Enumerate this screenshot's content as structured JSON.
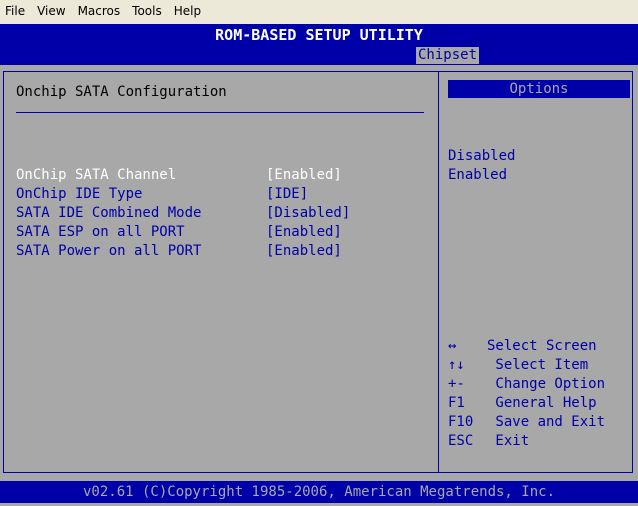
{
  "menubar": {
    "items": [
      "File",
      "View",
      "Macros",
      "Tools",
      "Help"
    ]
  },
  "bios": {
    "title": "ROM-BASED SETUP UTILITY",
    "active_tab": "Chipset",
    "section_title": "Onchip SATA Configuration",
    "settings": [
      {
        "label": "OnChip SATA Channel",
        "value": "[Enabled]",
        "selected": true
      },
      {
        "label": "OnChip IDE Type",
        "value": "[IDE]",
        "selected": false
      },
      {
        "label": "SATA IDE Combined Mode",
        "value": "[Disabled]",
        "selected": false
      },
      {
        "label": "SATA ESP on all PORT",
        "value": "[Enabled]",
        "selected": false
      },
      {
        "label": "SATA Power on all PORT",
        "value": "[Enabled]",
        "selected": false
      }
    ],
    "options_header": "Options",
    "options": [
      "Disabled",
      "Enabled"
    ],
    "help": [
      {
        "key": "↔",
        "desc": "Select Screen"
      },
      {
        "key": "↑↓",
        "desc": " Select Item"
      },
      {
        "key": "+-",
        "desc": " Change Option"
      },
      {
        "key": "F1",
        "desc": " General Help"
      },
      {
        "key": "F10",
        "desc": " Save and Exit"
      },
      {
        "key": "ESC",
        "desc": " Exit"
      }
    ],
    "footer": "v02.61 (C)Copyright 1985-2006, American Megatrends, Inc."
  },
  "colors": {
    "bios_blue": "#0000a8",
    "bios_gray": "#a8a8a8",
    "highlight": "#ffffff"
  }
}
